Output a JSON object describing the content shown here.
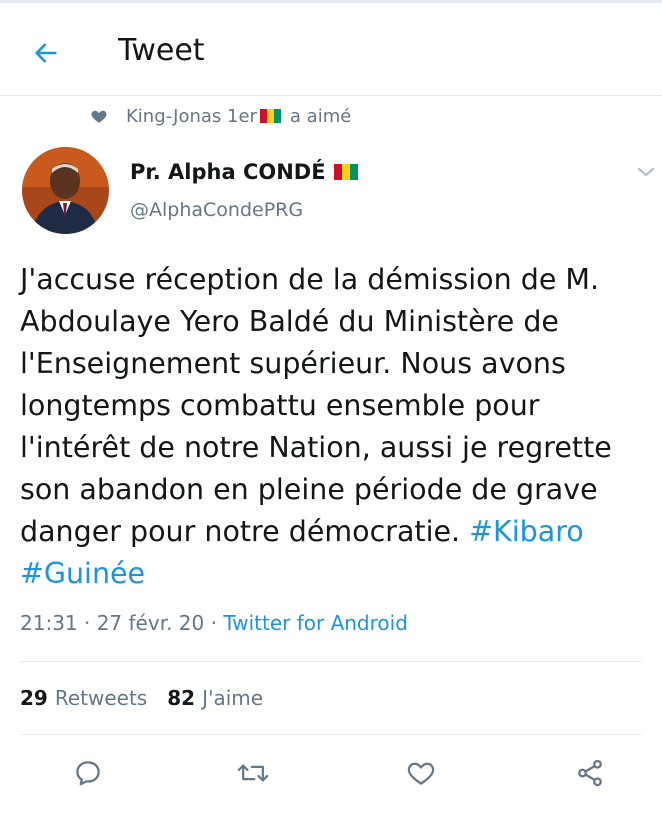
{
  "header": {
    "title": "Tweet",
    "back_icon": "arrow-left-icon"
  },
  "social_context": {
    "icon": "heart-icon",
    "user": "King-Jonas 1er",
    "action": "a aimé"
  },
  "tweet": {
    "author_name": "Pr. Alpha CONDÉ",
    "author_handle": "@AlphaCondePRG",
    "text_lines": [
      "J'accuse réception de la démission de M.",
      "Abdoulaye Yero Baldé du Ministère de",
      "l'Enseignement supérieur. Nous avons",
      "longtemps combattu ensemble pour",
      "l'intérêt de notre Nation, aussi je regrette",
      "son abandon en pleine période de grave",
      "danger pour notre démocratie. "
    ],
    "hashtags": [
      "#Kibaro",
      "#Guinée"
    ],
    "time": "21:31 · 27 févr. 20 · ",
    "source": "Twitter for Android"
  },
  "stats": {
    "retweets_count": "29",
    "retweets_label": "Retweets",
    "likes_count": "82",
    "likes_label": "J'aime"
  },
  "actions": [
    "reply-icon",
    "retweet-icon",
    "like-icon",
    "share-icon"
  ],
  "colors": {
    "accent": "#1b95e0",
    "text": "#14171a",
    "secondary": "#657786",
    "divider": "#e6ecf0"
  }
}
